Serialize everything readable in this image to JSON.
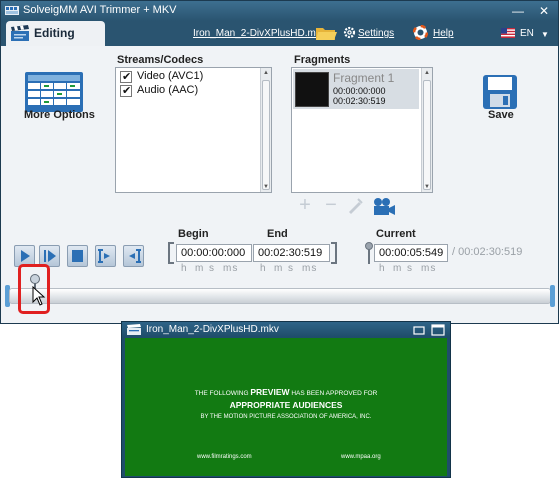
{
  "window": {
    "title": "SolveigMM AVI Trimmer + MKV",
    "minimize": "—",
    "close": "✕"
  },
  "toolbar": {
    "tab_label": "Editing",
    "file_name": "Iron_Man_2-DivXPlusHD.mkv",
    "settings_label": "Settings",
    "help_label": "Help",
    "language": "EN",
    "colors": {
      "titlebar": "#2a5470",
      "panel": "#f0f3f6",
      "accent": "#2b6fb5"
    }
  },
  "actions": {
    "more_options_label": "More Options",
    "save_label": "Save"
  },
  "streams": {
    "title": "Streams/Codecs",
    "items": [
      {
        "label": "Video (AVC1)",
        "checked": true
      },
      {
        "label": "Audio (AAC)",
        "checked": true
      }
    ]
  },
  "fragments": {
    "title": "Fragments",
    "items": [
      {
        "name": "Fragment 1",
        "start": "00:00:00:000",
        "end": "00:02:30:519"
      }
    ],
    "tools": [
      "add-icon",
      "remove-icon",
      "clear-icon",
      "video-camera-icon"
    ]
  },
  "time": {
    "begin_label": "Begin",
    "begin_value": "00:00:00:000",
    "end_label": "End",
    "end_value": "00:02:30:519",
    "current_label": "Current",
    "current_value": "00:00:05:549",
    "total_duration": "/ 00:02:30:519",
    "units": [
      "h",
      "m",
      "s",
      "ms"
    ]
  },
  "playback": {
    "buttons": [
      "play-icon",
      "play-selection-icon",
      "stop-icon",
      "set-begin-marker-icon",
      "set-end-marker-icon"
    ]
  },
  "preview": {
    "title": "Iron_Man_2-DivXPlusHD.mkv",
    "line1_pre": "THE FOLLOWING",
    "line1_highlight": "PREVIEW",
    "line1_post": "HAS BEEN APPROVED FOR",
    "line2": "APPROPRIATE AUDIENCES",
    "line3": "BY THE MOTION PICTURE ASSOCIATION OF AMERICA, INC.",
    "url_left": "www.filmratings.com",
    "url_right": "www.mpaa.org",
    "video_color": "#127a12"
  }
}
